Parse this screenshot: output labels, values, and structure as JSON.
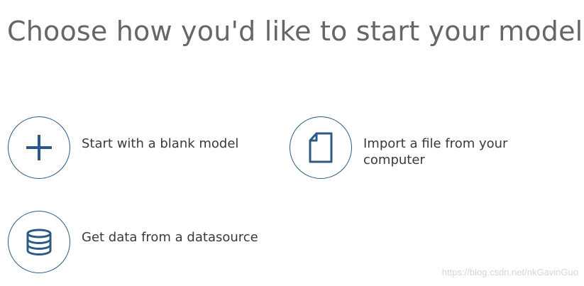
{
  "page": {
    "title": "Choose how you'd like to start your model"
  },
  "options": [
    {
      "label": "Start with a blank model",
      "icon": "plus-icon"
    },
    {
      "label": "Import a file from your computer",
      "icon": "file-icon"
    },
    {
      "label": "Get data from a datasource",
      "icon": "database-icon"
    }
  ],
  "colors": {
    "accent": "#2c5a86",
    "title": "#666666",
    "text": "#3a3a3a"
  },
  "watermark": "https://blog.csdn.net/nkGavinGuo"
}
